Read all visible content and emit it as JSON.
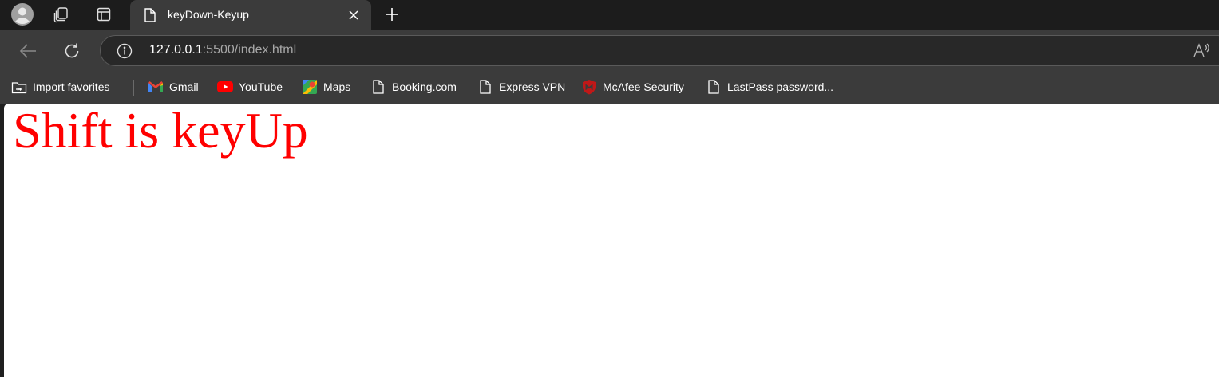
{
  "browser": {
    "tab": {
      "title": "keyDown-Keyup"
    },
    "address": {
      "host": "127.0.0.1",
      "rest": ":5500/index.html"
    },
    "bookmarks": [
      {
        "label": "Import favorites",
        "icon": "import-favorites-icon"
      },
      {
        "label": "Gmail",
        "icon": "gmail-icon"
      },
      {
        "label": "YouTube",
        "icon": "youtube-icon"
      },
      {
        "label": "Maps",
        "icon": "maps-icon"
      },
      {
        "label": "Booking.com",
        "icon": "page-icon"
      },
      {
        "label": "Express VPN",
        "icon": "page-icon"
      },
      {
        "label": "McAfee Security",
        "icon": "mcafee-icon"
      },
      {
        "label": "LastPass password...",
        "icon": "page-icon"
      }
    ]
  },
  "page": {
    "message": "Shift is keyUp",
    "message_color": "#ff0000"
  },
  "colors": {
    "tabstrip": "#1c1c1c",
    "toolbar": "#3b3b3b",
    "omnibox": "#282828",
    "content": "#ffffff"
  }
}
